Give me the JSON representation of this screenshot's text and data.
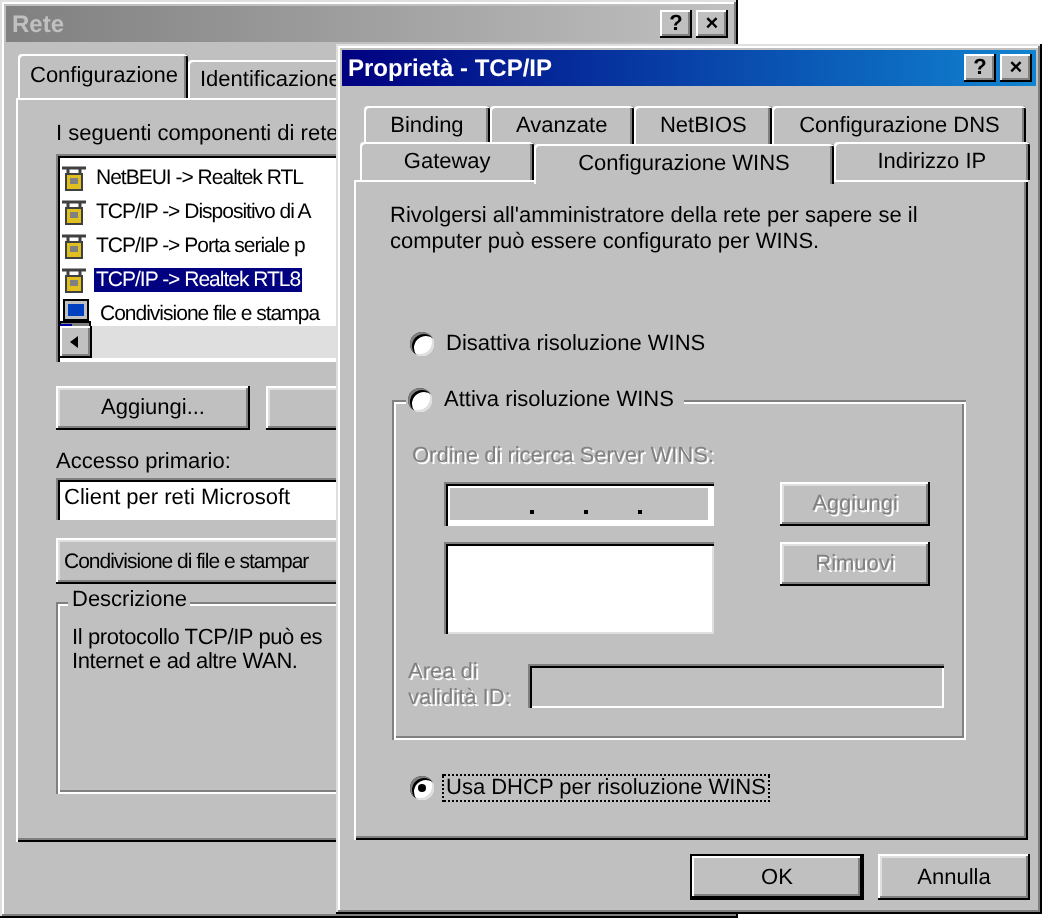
{
  "back_window": {
    "title": "Rete",
    "active": false,
    "controls": [
      "?",
      "×"
    ],
    "tabs": [
      {
        "label": "Configurazione",
        "selected": true
      },
      {
        "label": "Identificazione",
        "selected": false
      }
    ],
    "components_label": "I seguenti componenti di rete",
    "components": [
      {
        "label": "NetBEUI -> Realtek RTL",
        "kind": "protocol",
        "selected": false
      },
      {
        "label": "TCP/IP -> Dispositivo di A",
        "kind": "protocol",
        "selected": false
      },
      {
        "label": "TCP/IP -> Porta seriale p",
        "kind": "protocol",
        "selected": false
      },
      {
        "label": "TCP/IP -> Realtek RTL8",
        "kind": "protocol",
        "selected": true
      },
      {
        "label": "Condivisione file e stampa",
        "kind": "service",
        "selected": false
      }
    ],
    "add_button": "Aggiungi...",
    "primary_logon_label": "Accesso primario:",
    "primary_logon": "Client per reti Microsoft",
    "sharing_button": "Condivisione di file e stampar",
    "description": {
      "title": "Descrizione",
      "lines": [
        "Il protocollo TCP/IP può es",
        "Internet e ad altre WAN."
      ]
    }
  },
  "dialog": {
    "title": "Proprietà - TCP/IP",
    "active": true,
    "controls": [
      "?",
      "×"
    ],
    "tab_rows": [
      [
        {
          "label": "Binding",
          "selected": false
        },
        {
          "label": "Avanzate",
          "selected": false
        },
        {
          "label": "NetBIOS",
          "selected": false
        },
        {
          "label": "Configurazione DNS",
          "selected": false
        }
      ],
      [
        {
          "label": "Gateway",
          "selected": false
        },
        {
          "label": "Configurazione WINS",
          "selected": true
        },
        {
          "label": "Indirizzo IP",
          "selected": false
        }
      ]
    ],
    "intro": "Rivolgersi all'amministratore della rete per sapere se il computer può essere configurato per WINS.",
    "options": [
      {
        "label": "Disattiva risoluzione WINS",
        "selected": false,
        "focused": false
      },
      {
        "label": "Attiva risoluzione WINS",
        "selected": false,
        "focused": false
      },
      {
        "label": "Usa DHCP per risoluzione WINS",
        "selected": true,
        "focused": true
      }
    ],
    "wins": {
      "disabled": true,
      "server_order_label": "Ordine di ricerca Server WINS:",
      "add_button": "Aggiungi",
      "remove_button": "Rimuovi",
      "scope_id_label": "Area di validità ID:"
    },
    "buttons": [
      {
        "label": "OK",
        "default": true
      },
      {
        "label": "Annulla",
        "default": false
      }
    ]
  }
}
